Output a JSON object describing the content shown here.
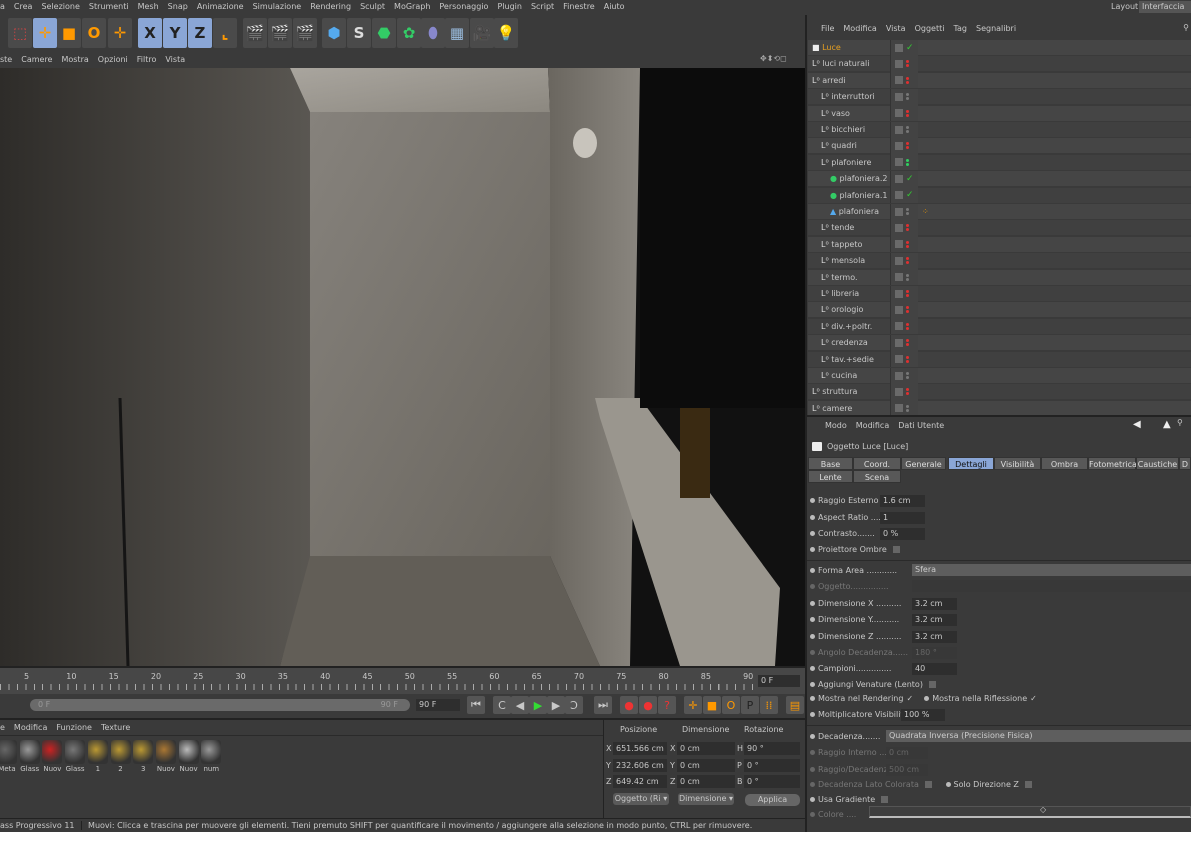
{
  "menubar": [
    "a",
    "Crea",
    "Selezione",
    "Strumenti",
    "Mesh",
    "Snap",
    "Animazione",
    "Simulazione",
    "Rendering",
    "Sculpt",
    "MoGraph",
    "Personaggio",
    "Plugin",
    "Script",
    "Finestre",
    "Aiuto"
  ],
  "layout": {
    "label": "Layout:",
    "value": "Interfaccia di"
  },
  "toolbar": [
    "live-selection-icon",
    "move-icon",
    "scale-icon",
    "rotate-icon",
    "add-icon",
    "x-axis-icon",
    "y-axis-icon",
    "z-axis-icon",
    "coord-system-icon",
    "render-view-icon",
    "render-picture-viewer-icon",
    "render-settings-icon",
    "cube-icon",
    "spline-icon",
    "nurbs-icon",
    "array-icon",
    "deformer-icon",
    "floor-icon",
    "camera-icon",
    "light-icon"
  ],
  "toolbar_letters": {
    "x": "X",
    "y": "Y",
    "z": "Z"
  },
  "viewport_menu": [
    "ste",
    "Camere",
    "Mostra",
    "Opzioni",
    "Filtro",
    "Vista"
  ],
  "object_manager": {
    "menu": [
      "File",
      "Modifica",
      "Vista",
      "Oggetti",
      "Tag",
      "Segnalibri"
    ],
    "items": [
      {
        "name": "Luce",
        "level": 0,
        "status": "check",
        "selected": true
      },
      {
        "name": "luci naturali",
        "level": 0,
        "status": "red"
      },
      {
        "name": "arredi",
        "level": 0,
        "status": "red"
      },
      {
        "name": "interruttori",
        "level": 1,
        "status": "grey"
      },
      {
        "name": "vaso",
        "level": 1,
        "status": "red"
      },
      {
        "name": "bicchieri",
        "level": 1,
        "status": "grey"
      },
      {
        "name": "quadri",
        "level": 1,
        "status": "red"
      },
      {
        "name": "plafoniere",
        "level": 1,
        "status": "green"
      },
      {
        "name": "plafoniera.2",
        "level": 2,
        "status": "check"
      },
      {
        "name": "plafoniera.1",
        "level": 2,
        "status": "check"
      },
      {
        "name": "plafoniera",
        "level": 2,
        "status": "grey",
        "tag": true
      },
      {
        "name": "tende",
        "level": 1,
        "status": "red"
      },
      {
        "name": "tappeto",
        "level": 1,
        "status": "red"
      },
      {
        "name": "mensola",
        "level": 1,
        "status": "red"
      },
      {
        "name": "termo.",
        "level": 1,
        "status": "grey"
      },
      {
        "name": "libreria",
        "level": 1,
        "status": "red"
      },
      {
        "name": "orologio",
        "level": 1,
        "status": "red"
      },
      {
        "name": "div.+poltr.",
        "level": 1,
        "status": "red"
      },
      {
        "name": "credenza",
        "level": 1,
        "status": "red"
      },
      {
        "name": "tav.+sedie",
        "level": 1,
        "status": "red"
      },
      {
        "name": "cucina",
        "level": 1,
        "status": "grey"
      },
      {
        "name": "struttura",
        "level": 0,
        "status": "red"
      },
      {
        "name": "camere",
        "level": 0,
        "status": "grey"
      }
    ]
  },
  "attributes": {
    "menu": [
      "Modo",
      "Modifica",
      "Dati Utente"
    ],
    "title": "Oggetto Luce [Luce]",
    "tabs": [
      "Base",
      "Coord.",
      "Generale",
      "Dettagli",
      "Visibilità",
      "Ombra",
      "Fotometrica",
      "Caustiche",
      "D",
      "Lente",
      "Scena"
    ],
    "active_tab": "Dettagli",
    "props1": [
      {
        "label": "Raggio Esterno",
        "value": "1.6 cm"
      },
      {
        "label": "Aspect Ratio ....",
        "value": "1"
      },
      {
        "label": "Contrasto.......",
        "value": "0 %"
      }
    ],
    "proiettore": "Proiettore Ombre",
    "forma_area": {
      "label": "Forma Area ............",
      "value": "Sfera"
    },
    "oggetto": "Oggetto...............",
    "dims": [
      {
        "label": "Dimensione X ..........",
        "value": "3.2 cm",
        "disabled": false
      },
      {
        "label": "Dimensione Y...........",
        "value": "3.2 cm",
        "disabled": false
      },
      {
        "label": "Dimensione Z ..........",
        "value": "3.2 cm",
        "disabled": false
      },
      {
        "label": "Angolo Decadenza......",
        "value": "180 °",
        "disabled": true
      },
      {
        "label": "Campioni..............",
        "value": "40",
        "disabled": false
      }
    ],
    "venature": "Aggiungi Venature (Lento)",
    "mostra_rendering": "Mostra nel Rendering",
    "mostra_riflessione": "Mostra nella Riflessione",
    "moltiplicatore": {
      "label": "Moltiplicatore Visibilità",
      "value": "100 %"
    },
    "decadenza": {
      "label": "Decadenza.......",
      "value": "Quadrata Inversa (Precisione Fisica)"
    },
    "raggio_interno": {
      "label": "Raggio Interno ...",
      "value": "0 cm"
    },
    "raggio_decadenza": {
      "label": "Raggio/Decadenza",
      "value": "500 cm"
    },
    "lato_colorata": "Decadenza Lato Colorata",
    "solo_z": "Solo Direzione Z",
    "gradiente": "Usa Gradiente",
    "colore": "Colore ...."
  },
  "timeline": {
    "ticks": [
      "5",
      "10",
      "15",
      "20",
      "25",
      "30",
      "35",
      "40",
      "45",
      "50",
      "55",
      "60",
      "65",
      "70",
      "75",
      "80",
      "85",
      "90"
    ],
    "current": "0 F",
    "range_start": "0 F",
    "range_end": "90 F",
    "end_field": "90 F"
  },
  "materials": {
    "menu": [
      "e",
      "Modifica",
      "Funzione",
      "Texture"
    ],
    "items": [
      "Meta",
      "Glass",
      "Nuov",
      "Glass",
      "1",
      "2",
      "3",
      "Nuov",
      "Nuov",
      "num"
    ]
  },
  "coords": {
    "headers": [
      "Posizione",
      "Dimensione",
      "Rotazione"
    ],
    "rows": [
      {
        "axis": "X",
        "pos": "651.566 cm",
        "dax": "X",
        "dim": "0 cm",
        "rax": "H",
        "rot": "90 °"
      },
      {
        "axis": "Y",
        "pos": "232.606 cm",
        "dax": "Y",
        "dim": "0 cm",
        "rax": "P",
        "rot": "0 °"
      },
      {
        "axis": "Z",
        "pos": "649.42 cm",
        "dax": "Z",
        "dim": "0 cm",
        "rax": "B",
        "rot": "0 °"
      }
    ],
    "mode": "Oggetto (Ri ▾",
    "dim_mode": "Dimensione ▾",
    "apply": "Applica"
  },
  "status": {
    "left": "ass Progressivo 11",
    "message": "Muovi: Clicca e trascina per muovere gli elementi. Tieni premuto SHIFT per quantificare il movimento / aggiungere alla selezione in modo punto, CTRL per rimuovere."
  },
  "colors": {
    "bg": "#3a3a3a",
    "selected_tab": "#8aa6d6",
    "active_object": "#e8a020",
    "red_dot": "#e03030",
    "green_dot": "#30d060"
  }
}
